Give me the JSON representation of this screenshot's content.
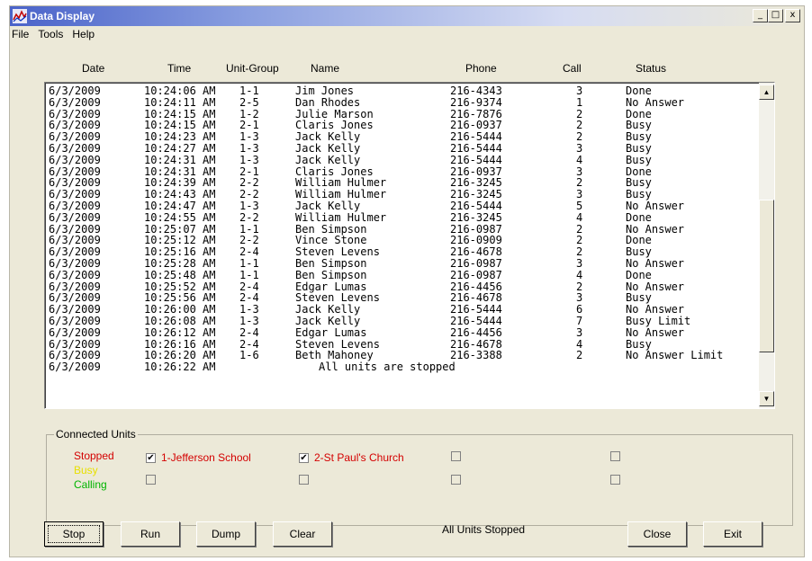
{
  "window": {
    "title": "Data Display",
    "controls": {
      "minimize": "_",
      "maximize": "□",
      "close": "x"
    }
  },
  "menu": [
    "File",
    "Tools",
    "Help"
  ],
  "columns": [
    "Date",
    "Time",
    "Unit-Group",
    "Name",
    "Phone",
    "Call",
    "Status"
  ],
  "rows": [
    [
      "6/3/2009",
      "10:24:06 AM",
      "1-1",
      "Jim Jones",
      "216-4343",
      "3",
      "Done"
    ],
    [
      "6/3/2009",
      "10:24:11 AM",
      "2-5",
      "Dan Rhodes",
      "216-9374",
      "1",
      "No Answer"
    ],
    [
      "6/3/2009",
      "10:24:15 AM",
      "1-2",
      "Julie Marson",
      "216-7876",
      "2",
      "Done"
    ],
    [
      "6/3/2009",
      "10:24:15 AM",
      "2-1",
      "Claris Jones",
      "216-0937",
      "2",
      "Busy"
    ],
    [
      "6/3/2009",
      "10:24:23 AM",
      "1-3",
      "Jack Kelly",
      "216-5444",
      "2",
      "Busy"
    ],
    [
      "6/3/2009",
      "10:24:27 AM",
      "1-3",
      "Jack Kelly",
      "216-5444",
      "3",
      "Busy"
    ],
    [
      "6/3/2009",
      "10:24:31 AM",
      "1-3",
      "Jack Kelly",
      "216-5444",
      "4",
      "Busy"
    ],
    [
      "6/3/2009",
      "10:24:31 AM",
      "2-1",
      "Claris Jones",
      "216-0937",
      "3",
      "Done"
    ],
    [
      "6/3/2009",
      "10:24:39 AM",
      "2-2",
      "William Hulmer",
      "216-3245",
      "2",
      "Busy"
    ],
    [
      "6/3/2009",
      "10:24:43 AM",
      "2-2",
      "William Hulmer",
      "216-3245",
      "3",
      "Busy"
    ],
    [
      "6/3/2009",
      "10:24:47 AM",
      "1-3",
      "Jack Kelly",
      "216-5444",
      "5",
      "No Answer"
    ],
    [
      "6/3/2009",
      "10:24:55 AM",
      "2-2",
      "William Hulmer",
      "216-3245",
      "4",
      "Done"
    ],
    [
      "6/3/2009",
      "10:25:07 AM",
      "1-1",
      "Ben Simpson",
      "216-0987",
      "2",
      "No Answer"
    ],
    [
      "6/3/2009",
      "10:25:12 AM",
      "2-2",
      "Vince Stone",
      "216-0909",
      "2",
      "Done"
    ],
    [
      "6/3/2009",
      "10:25:16 AM",
      "2-4",
      "Steven Levens",
      "216-4678",
      "2",
      "Busy"
    ],
    [
      "6/3/2009",
      "10:25:28 AM",
      "1-1",
      "Ben Simpson",
      "216-0987",
      "3",
      "No Answer"
    ],
    [
      "6/3/2009",
      "10:25:48 AM",
      "1-1",
      "Ben Simpson",
      "216-0987",
      "4",
      "Done"
    ],
    [
      "6/3/2009",
      "10:25:52 AM",
      "2-4",
      "Edgar Lumas",
      "216-4456",
      "2",
      "No Answer"
    ],
    [
      "6/3/2009",
      "10:25:56 AM",
      "2-4",
      "Steven Levens",
      "216-4678",
      "3",
      "Busy"
    ],
    [
      "6/3/2009",
      "10:26:00 AM",
      "1-3",
      "Jack Kelly",
      "216-5444",
      "6",
      "No Answer"
    ],
    [
      "6/3/2009",
      "10:26:08 AM",
      "1-3",
      "Jack Kelly",
      "216-5444",
      "7",
      "Busy Limit"
    ],
    [
      "6/3/2009",
      "10:26:12 AM",
      "2-4",
      "Edgar Lumas",
      "216-4456",
      "3",
      "No Answer"
    ],
    [
      "6/3/2009",
      "10:26:16 AM",
      "2-4",
      "Steven Levens",
      "216-4678",
      "4",
      "Busy"
    ],
    [
      "6/3/2009",
      "10:26:20 AM",
      "1-6",
      "Beth Mahoney",
      "216-3388",
      "2",
      "No Answer Limit"
    ]
  ],
  "last_row": {
    "date": "6/3/2009",
    "time": "10:26:22 AM",
    "message": "All units are stopped"
  },
  "scrollbar": {
    "up": "▲",
    "down": "▼"
  },
  "connected_units": {
    "title": "Connected Units",
    "legend": {
      "stopped": {
        "label": "Stopped",
        "color": "#d40000"
      },
      "busy": {
        "label": "Busy",
        "color": "#e8e000"
      },
      "calling": {
        "label": "Calling",
        "color": "#00b400"
      }
    },
    "units": [
      {
        "label": "1-Jefferson School",
        "checked": "✔"
      },
      {
        "label": "2-St Paul's Church",
        "checked": "✔"
      }
    ],
    "unit_color": "#d40000"
  },
  "buttons": {
    "stop": "Stop",
    "run": "Run",
    "dump": "Dump",
    "clear": "Clear",
    "close": "Close",
    "exit": "Exit"
  },
  "status": "All Units Stopped"
}
